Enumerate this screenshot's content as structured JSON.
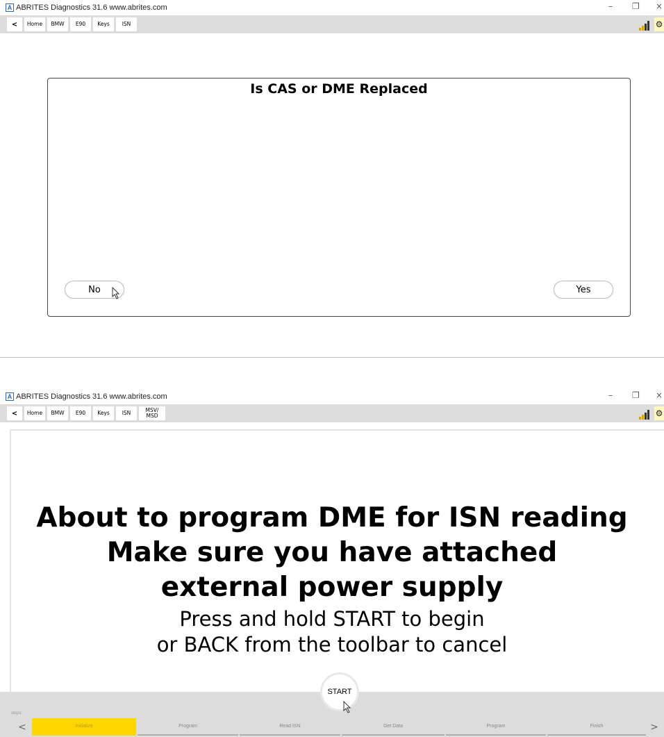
{
  "colors": {
    "accent_yellow": "#ffd700",
    "toolbar_gray": "#dcdcdc",
    "logo_blue": "#2a63c6"
  },
  "app": {
    "logo": "A",
    "title": "ABRITES Diagnostics 31.6   www.abrites.com"
  },
  "window_controls": {
    "minimize": "–",
    "restore": "❐",
    "close": "×"
  },
  "panel1": {
    "toolbar": {
      "back": "<",
      "breadcrumbs": [
        "Home",
        "BMW",
        "E90",
        "Keys",
        "ISN"
      ],
      "settings_icon": "gear-icon",
      "signal_icon": "signal-bars-icon"
    },
    "dialog": {
      "title": "Is CAS or DME Replaced",
      "no_label": "No",
      "yes_label": "Yes"
    }
  },
  "panel2": {
    "toolbar": {
      "back": "<",
      "breadcrumbs": [
        "Home",
        "BMW",
        "E90",
        "Keys",
        "ISN",
        "MSV/\nMSD"
      ],
      "settings_icon": "gear-icon",
      "signal_icon": "signal-bars-icon"
    },
    "message": {
      "line1": "About to program DME for ISN reading",
      "line2": "Make sure you have attached",
      "line3": "external power supply",
      "line4": "Press and hold START to begin",
      "line5": "or BACK from the toolbar to cancel"
    },
    "start_label": "START",
    "steps_label": "steps:",
    "steps": [
      "Initialize",
      "Program",
      "Read ISN",
      "Get Data",
      "Program",
      "Finish"
    ],
    "active_step": 0,
    "nav_prev": "<",
    "nav_next": ">"
  }
}
